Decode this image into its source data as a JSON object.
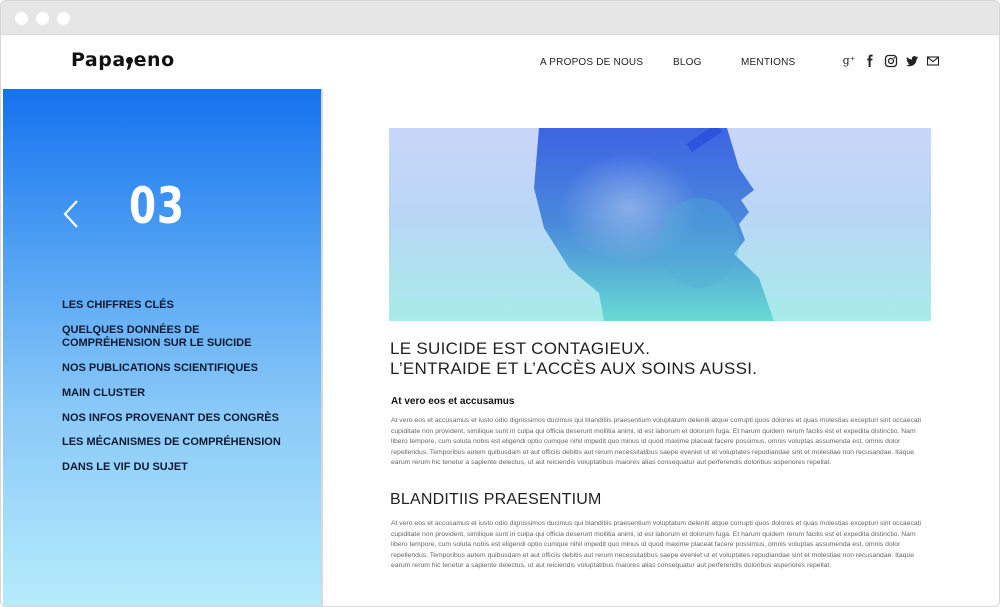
{
  "header": {
    "logo_left": "Papa",
    "logo_right": "eno",
    "nav": [
      "A PROPOS DE NOUS",
      "BLOG",
      "MENTIONS"
    ],
    "social_icons": [
      "google-plus-icon",
      "facebook-icon",
      "instagram-icon",
      "twitter-icon",
      "mail-icon"
    ],
    "gplus_glyph": "g⁺"
  },
  "sidebar": {
    "number": "03",
    "items": [
      "LES CHIFFRES CLÉS",
      "QUELQUES DONNÉES DE COMPRÉHENSION SUR LE SUICIDE",
      "NOS PUBLICATIONS SCIENTIFIQUES",
      "MAIN CLUSTER",
      "NOS INFOS PROVENANT DES CONGRÈS",
      "LES MÉCANISMES DE COMPRÉHENSION",
      "DANS LE VIF DU SUJET"
    ]
  },
  "article": {
    "title_line1": "LE SUICIDE EST CONTAGIEUX.",
    "title_line2": "L’ENTRAIDE ET L’ACCÈS AUX SOINS AUSSI.",
    "subtitle": "At vero eos et accusamus",
    "paragraph1": "At vero eos et accusamus et iusto odio dignissimos ducimus qui blanditiis praesentium voluptatum deleniti atque corrupti quos dolores et quas molestias excepturi sint occaecati cupiditate non provident, similique sunt in culpa qui officia deserunt mollitia animi, id est laborum et dolorum fuga. Et harum quidem rerum facilis est et expedita distinctio. Nam libero tempore, cum soluta nobis est eligendi optio cumque nihil impedit quo minus id quod maxime placeat facere possimus, omnis voluptas assumenda est, omnis dolor repellendus. Temporibus autem quibusdam et aut officiis debitis aut rerum necessitatibus saepe eveniet ut et voluptates repudiandae sint et molestiae non recusandae. Itaque earum rerum hic tenetur a sapiente delectus, ut aut reiciendis voluptatibus maiores alias consequatur aut perferendis doloribus asperiores repellat.",
    "heading2": "BLANDITIIS PRAESENTIUM",
    "paragraph2": "At vero eos et accusamus et iusto odio dignissimos ducimus qui blanditiis praesentium voluptatum deleniti atque corrupti quos dolores et quas molestias excepturi sint occaecati cupiditate non provident, similique sunt in culpa qui officia deserunt mollitia animi, id est laborum et dolorum fuga. Et harum quidem rerum facilis est et expedita distinctio. Nam libero tempore, cum soluta nobis est eligendi optio cumque nihil impedit quo minus id quod maxime placeat facere possimus, omnis voluptas assumenda est, omnis dolor repellendus. Temporibus autem quibusdam et aut officiis debitis aut rerum necessitatibus saepe eveniet ut et voluptates repudiandae sint et molestiae non recusandae. Itaque earum rerum hic tenetur a sapiente delectus, ut aut reiciendis voluptatibus maiores alias consequatur aut perferendis doloribus asperiores repellat."
  },
  "colors": {
    "sidebar_top": "#1572ee",
    "sidebar_bottom": "#b6ecfb",
    "menu_text": "#0e1a33",
    "hero_blue": "#2a55e0",
    "hero_teal": "#5fd8cf"
  }
}
